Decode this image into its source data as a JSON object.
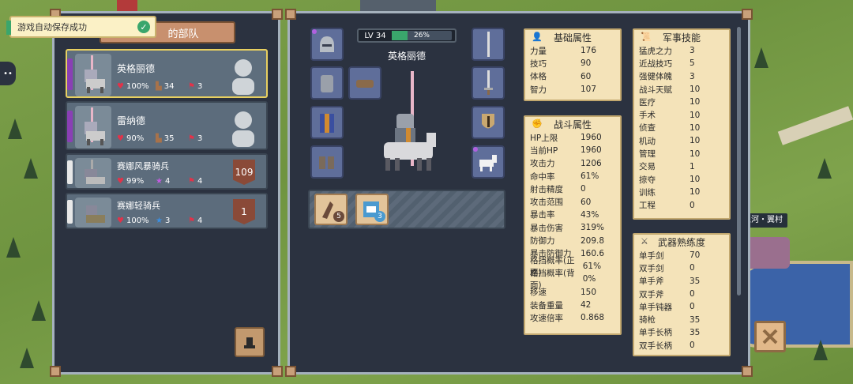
{
  "toast": {
    "text": "游戏自动保存成功"
  },
  "left_panel": {
    "tab_label": "的部队",
    "units": [
      {
        "name": "英格丽德",
        "hp": "100%",
        "boots": "34",
        "flag": "3",
        "selected": true
      },
      {
        "name": "雷纳德",
        "hp": "90%",
        "boots": "35",
        "flag": "3"
      },
      {
        "name": "赛娜风暴骑兵",
        "hp": "99%",
        "stars": "4",
        "flag": "4",
        "count": "109"
      },
      {
        "name": "赛娜轻骑兵",
        "hp": "100%",
        "stars": "3",
        "flag": "4",
        "count": "1"
      }
    ]
  },
  "character": {
    "level_label": "LV 34",
    "xp_percent": "26%",
    "xp_fraction": 0.26,
    "name": "英格丽德",
    "skill_slots": [
      {
        "count": "5"
      },
      {
        "count": "3"
      }
    ]
  },
  "basic_attrs": {
    "title": "基础属性",
    "rows": [
      {
        "k": "力量",
        "v": "176"
      },
      {
        "k": "技巧",
        "v": "90"
      },
      {
        "k": "体格",
        "v": "60"
      },
      {
        "k": "智力",
        "v": "107"
      }
    ]
  },
  "combat_attrs": {
    "title": "战斗属性",
    "rows": [
      {
        "k": "HP上限",
        "v": "1960"
      },
      {
        "k": "当前HP",
        "v": "1960"
      },
      {
        "k": "攻击力",
        "v": "1206"
      },
      {
        "k": "命中率",
        "v": "61%"
      },
      {
        "k": "射击精度",
        "v": "0"
      },
      {
        "k": "攻击范围",
        "v": "60"
      },
      {
        "k": "暴击率",
        "v": "43%"
      },
      {
        "k": "暴击伤害",
        "v": "319%"
      },
      {
        "k": "防御力",
        "v": "209.8"
      },
      {
        "k": "暴击防御力",
        "v": "160.6"
      },
      {
        "k": "格挡概率(正面)",
        "v": "61%"
      },
      {
        "k": "格挡概率(背面)",
        "v": "0%"
      },
      {
        "k": "移速",
        "v": "150"
      },
      {
        "k": "装备重量",
        "v": "42"
      },
      {
        "k": "攻速倍率",
        "v": "0.868"
      }
    ]
  },
  "military_skills": {
    "title": "军事技能",
    "rows": [
      {
        "k": "猛虎之力",
        "v": "3"
      },
      {
        "k": "近战技巧",
        "v": "5"
      },
      {
        "k": "强健体魄",
        "v": "3"
      },
      {
        "k": "战斗天赋",
        "v": "10"
      },
      {
        "k": "医疗",
        "v": "10"
      },
      {
        "k": "手术",
        "v": "10"
      },
      {
        "k": "侦查",
        "v": "10"
      },
      {
        "k": "机动",
        "v": "10"
      },
      {
        "k": "管理",
        "v": "10"
      },
      {
        "k": "交易",
        "v": "1"
      },
      {
        "k": "掠夺",
        "v": "10"
      },
      {
        "k": "训练",
        "v": "10"
      },
      {
        "k": "工程",
        "v": "0"
      }
    ]
  },
  "weapon_mastery": {
    "title": "武器熟练度",
    "rows": [
      {
        "k": "单手剑",
        "v": "70"
      },
      {
        "k": "双手剑",
        "v": "0"
      },
      {
        "k": "单手斧",
        "v": "35"
      },
      {
        "k": "双手斧",
        "v": "0"
      },
      {
        "k": "单手钝器",
        "v": "0"
      },
      {
        "k": "骑枪",
        "v": "35"
      },
      {
        "k": "单手长柄",
        "v": "35"
      },
      {
        "k": "双手长柄",
        "v": "0"
      }
    ]
  },
  "map": {
    "location_label": "星之河・翼村"
  },
  "colors": {
    "panel_bg": "#2b3240",
    "card_bg": "#5c6c7c",
    "stat_bg": "#f4e3b9",
    "selected_border": "#e8d060",
    "xp_fill": "#3aa66c"
  }
}
